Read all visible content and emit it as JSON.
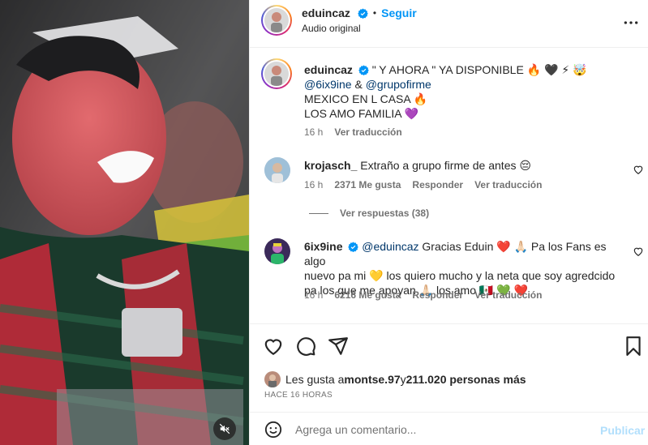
{
  "post": {
    "username": "eduincaz",
    "follow_label": "Seguir",
    "audio_label": "Audio original",
    "separator": "•"
  },
  "caption": {
    "username": "eduincaz",
    "line1": "\" Y AHORA \" YA DISPONIBLE 🔥 🖤 ⚡ 🤯",
    "mention1": "@6ix9ine",
    "amp": " & ",
    "mention2": "@grupofirme",
    "line3": "MEXICO EN L CASA 🔥",
    "line4": "LOS AMO FAMILIA 💜",
    "time": "16 h",
    "translate": "Ver traducción"
  },
  "comments": [
    {
      "username": "krojasch_",
      "text": "Extraño a grupo firme de antes 😔",
      "time": "16 h",
      "likes": "2371 Me gusta",
      "reply": "Responder",
      "translate": "Ver traducción",
      "replies_label": "Ver respuestas (38)"
    },
    {
      "username": "6ix9ine",
      "mention": "@eduincaz",
      "text_line1": " Gracias Eduin ❤️ 🙏🏻  Pa los Fans es algo",
      "text_line2": "nuevo pa mi 💛  los quiero mucho y la neta que soy agredcido",
      "text_line3": "pa los que me apoyan 🙏🏻  los amo 🇲🇽 💚 ❤️",
      "time": "16 h",
      "likes": "6216 Me gusta",
      "reply": "Responder",
      "translate": "Ver traducción"
    }
  ],
  "likes": {
    "prefix": "Les gusta a ",
    "user": "montse.97",
    "middle": " y ",
    "count": "211.020 personas más"
  },
  "time_ago": "HACE 16 HORAS",
  "composer": {
    "placeholder": "Agrega un comentario...",
    "publish": "Publicar"
  },
  "colors": {
    "accent": "#0095f6",
    "verified": "#0095f6",
    "publish_disabled": "#b2dffc",
    "muted": "#737373"
  },
  "icons": [
    "verified-icon",
    "more-options-icon",
    "heart-icon",
    "comment-icon",
    "share-icon",
    "save-icon",
    "emoji-icon",
    "mute-icon"
  ]
}
